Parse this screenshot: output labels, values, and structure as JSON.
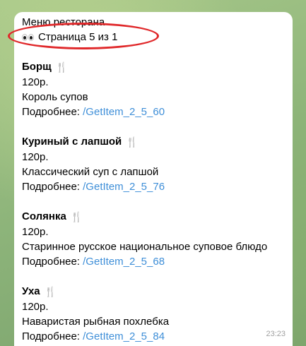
{
  "message": {
    "title": "Меню ресторана",
    "page_indicator": "Страница 5 из 1",
    "timestamp": "23:23",
    "details_label": "Подробнее: ",
    "items": [
      {
        "name": "Борщ",
        "price": "120р.",
        "description": "Король супов",
        "command": "/GetItem_2_5_60"
      },
      {
        "name": "Куриный с лапшой",
        "price": "120р.",
        "description": "Классический суп с лапшой",
        "command": "/GetItem_2_5_76"
      },
      {
        "name": "Солянка",
        "price": "120р.",
        "description": "Старинное русское национальное суповое блюдо",
        "command": "/GetItem_2_5_68"
      },
      {
        "name": "Уха",
        "price": "120р.",
        "description": "Наваристая рыбная похлебка",
        "command": "/GetItem_2_5_84"
      }
    ]
  },
  "icons": {
    "page_indicator_icon": "eyes-icon",
    "item_icon": "fork-and-knife-icon"
  },
  "colors": {
    "link": "#3f8fd8",
    "highlight": "#e0282a",
    "bubble": "#ffffff",
    "chat_background": "#8fb27a"
  }
}
